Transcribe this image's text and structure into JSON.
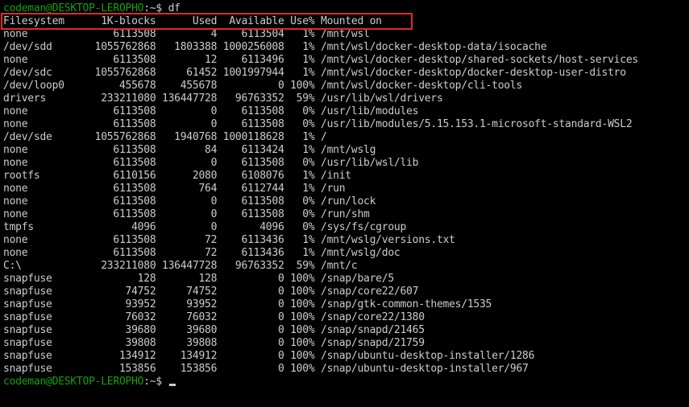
{
  "prompt": {
    "user_host": "codeman@DESKTOP-LEROPHO",
    "path": ":~$",
    "command": " df"
  },
  "header": "Filesystem      1K-blocks      Used  Available Use% Mounted on",
  "rows": [
    "none              6113508         4    6113504   1% /mnt/wsl",
    "/dev/sdd       1055762868   1803388 1000256008   1% /mnt/wsl/docker-desktop-data/isocache",
    "none              6113508        12    6113496   1% /mnt/wsl/docker-desktop/shared-sockets/host-services",
    "/dev/sdc       1055762868     61452 1001997944   1% /mnt/wsl/docker-desktop/docker-desktop-user-distro",
    "/dev/loop0         455678    455678          0 100% /mnt/wsl/docker-desktop/cli-tools",
    "drivers         233211080 136447728   96763352  59% /usr/lib/wsl/drivers",
    "none              6113508         0    6113508   0% /usr/lib/modules",
    "none              6113508         0    6113508   0% /usr/lib/modules/5.15.153.1-microsoft-standard-WSL2",
    "/dev/sde       1055762868   1940768 1000118628   1% /",
    "none              6113508        84    6113424   1% /mnt/wslg",
    "none              6113508         0    6113508   0% /usr/lib/wsl/lib",
    "rootfs            6110156      2080    6108076   1% /init",
    "none              6113508       764    6112744   1% /run",
    "none              6113508         0    6113508   0% /run/lock",
    "none              6113508         0    6113508   0% /run/shm",
    "tmpfs                4096         0       4096   0% /sys/fs/cgroup",
    "none              6113508        72    6113436   1% /mnt/wslg/versions.txt",
    "none              6113508        72    6113436   1% /mnt/wslg/doc",
    "C:\\             233211080 136447728   96763352  59% /mnt/c",
    "snapfuse              128       128          0 100% /snap/bare/5",
    "snapfuse            74752     74752          0 100% /snap/core22/607",
    "snapfuse            93952     93952          0 100% /snap/gtk-common-themes/1535",
    "snapfuse            76032     76032          0 100% /snap/core22/1380",
    "snapfuse            39680     39680          0 100% /snap/snapd/21465",
    "snapfuse            39808     39808          0 100% /snap/snapd/21759",
    "snapfuse           134912    134912          0 100% /snap/ubuntu-desktop-installer/1286",
    "snapfuse           153856    153856          0 100% /snap/ubuntu-desktop-installer/967"
  ],
  "colors": {
    "background": "#000000",
    "text": "#cccccc",
    "prompt_user": "#13a10e",
    "highlight": "#e0272f"
  }
}
